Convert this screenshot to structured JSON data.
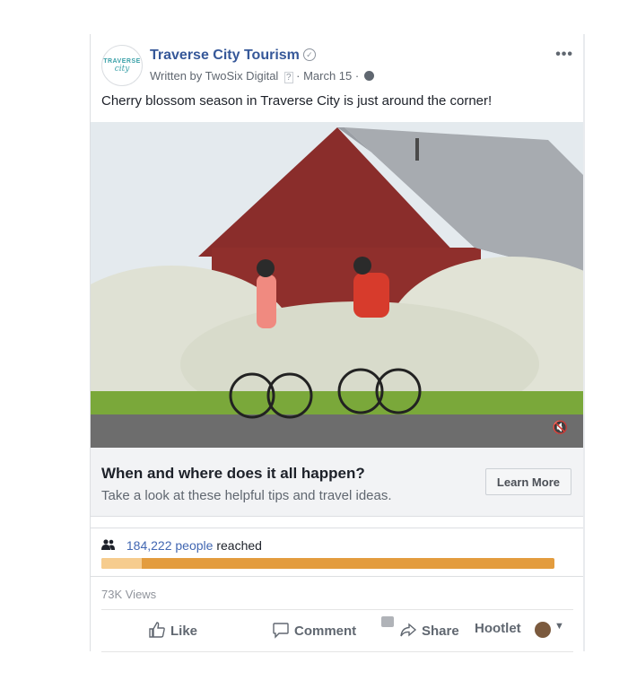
{
  "post": {
    "page_name": "Traverse City Tourism",
    "avatar_line1": "TRAVERSE",
    "avatar_line2": "city",
    "written_by": "Written by",
    "author": "TwoSix Digital",
    "author_hint": "?",
    "date": "· March 15 ·",
    "more_label": "•••",
    "text": "Cherry blossom season in Traverse City is just around the corner!"
  },
  "cta": {
    "title": "When and where does it all happen?",
    "description": "Take a look at these helpful tips and travel ideas.",
    "button_label": "Learn More"
  },
  "insights": {
    "reach_count": "184,222 people",
    "reach_suffix": "reached",
    "reach_fraction": 0.09,
    "views": "73K Views"
  },
  "actions": {
    "like": "Like",
    "comment": "Comment",
    "share": "Share",
    "hootlet": "Hootlet"
  },
  "icons": {
    "verified": "verified-check-icon",
    "globe": "globe-icon",
    "mute": "muted-speaker-icon",
    "reach": "people-icon",
    "like": "thumbs-up-icon",
    "comment": "speech-bubble-icon",
    "share": "share-arrow-icon",
    "dropdown": "caret-down-icon"
  },
  "colors": {
    "link": "#365899",
    "reach_bar": "#e39c3e",
    "reach_bar_light": "#f6cc8e",
    "cta_bg": "#f2f3f5"
  }
}
